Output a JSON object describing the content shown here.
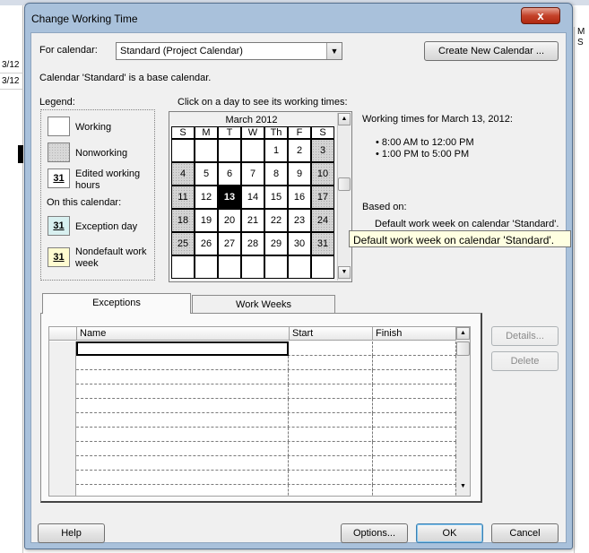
{
  "background": {
    "left_rows": [
      "3/12",
      "3/12"
    ],
    "right_rows": [
      "M",
      "S"
    ]
  },
  "dialog": {
    "title": "Change Working Time",
    "close_label": "x",
    "for_calendar_label": "For calendar:",
    "for_calendar_value": "Standard (Project Calendar)",
    "create_new_calendar_label": "Create New Calendar ...",
    "base_calendar_note": "Calendar 'Standard' is a base calendar.",
    "legend": {
      "title": "Legend:",
      "working": "Working",
      "nonworking": "Nonworking",
      "edited": "Edited working hours",
      "on_this_calendar": "On this calendar:",
      "exception": "Exception day",
      "nondefault": "Nondefault work week",
      "day_number": "31"
    },
    "calendar": {
      "instruction": "Click on a day to see its working times:",
      "month_title": "March 2012",
      "weekdays": [
        "S",
        "M",
        "T",
        "W",
        "Th",
        "F",
        "S"
      ],
      "weeks": [
        [
          "",
          "",
          "",
          "",
          "1",
          "2",
          "3"
        ],
        [
          "4",
          "5",
          "6",
          "7",
          "8",
          "9",
          "10"
        ],
        [
          "11",
          "12",
          "13",
          "14",
          "15",
          "16",
          "17"
        ],
        [
          "18",
          "19",
          "20",
          "21",
          "22",
          "23",
          "24"
        ],
        [
          "25",
          "26",
          "27",
          "28",
          "29",
          "30",
          "31"
        ],
        [
          "",
          "",
          "",
          "",
          "",
          "",
          ""
        ]
      ],
      "selected_day": "13"
    },
    "working_times": {
      "heading": "Working times for March 13, 2012:",
      "times": [
        "8:00 AM to 12:00 PM",
        "1:00 PM to 5:00 PM"
      ],
      "based_on_label": "Based on:",
      "based_on_value": "Default work week on calendar 'Standard'.",
      "tooltip": "Default work week on calendar 'Standard'."
    },
    "tabs": {
      "exceptions": "Exceptions",
      "work_weeks": "Work Weeks"
    },
    "grid": {
      "columns": [
        "Name",
        "Start",
        "Finish"
      ]
    },
    "details_label": "Details...",
    "delete_label": "Delete",
    "help_label": "Help",
    "options_label": "Options...",
    "ok_label": "OK",
    "cancel_label": "Cancel"
  }
}
